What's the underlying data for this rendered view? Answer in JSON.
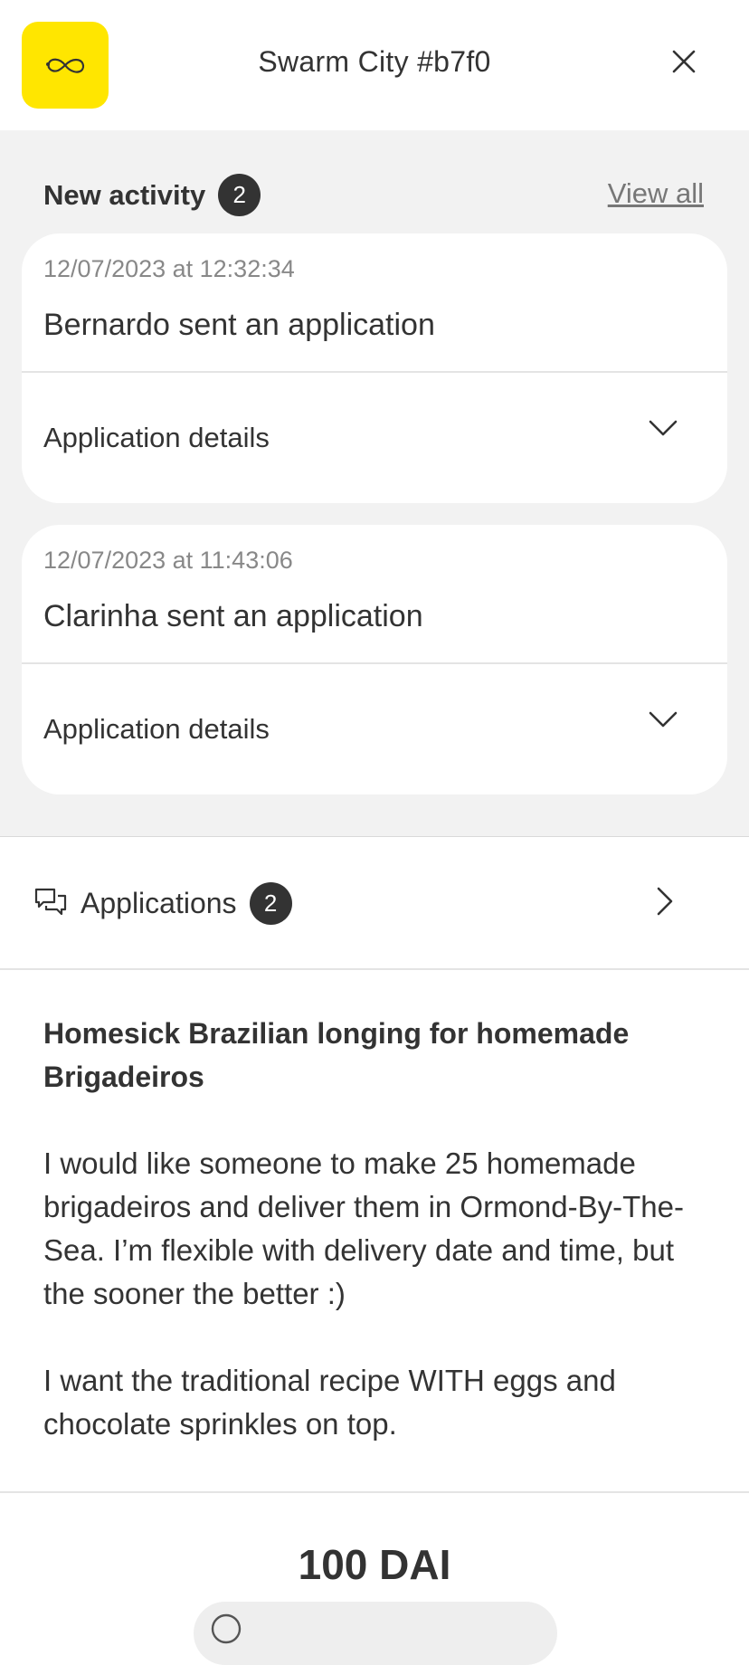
{
  "header": {
    "title": "Swarm City #b7f0",
    "logo_icon": "infinity-icon",
    "close_icon": "close-icon"
  },
  "activity": {
    "title": "New activity",
    "count": "2",
    "view_all": "View all",
    "items": [
      {
        "timestamp": "12/07/2023 at 12:32:34",
        "message": "Bernardo sent an application",
        "details_label": "Application details"
      },
      {
        "timestamp": "12/07/2023 at 11:43:06",
        "message": "Clarinha sent an application",
        "details_label": "Application details"
      }
    ]
  },
  "applications": {
    "label": "Applications",
    "count": "2",
    "icon": "chat-bubbles-icon"
  },
  "request": {
    "title": "Homesick Brazilian longing for homemade Brigadeiros",
    "description": [
      "I would like someone to make 25 homemade brigadeiros and deliver them in Ormond-By-The-Sea. I’m flexible with delivery date and time, but the sooner the better :)",
      "I want the traditional recipe WITH eggs and chocolate sprinkles on top."
    ],
    "amount": "100 DAI"
  },
  "colors": {
    "brand_yellow": "#ffe600",
    "badge_bg": "#333333",
    "section_bg": "#f2f2f2"
  }
}
